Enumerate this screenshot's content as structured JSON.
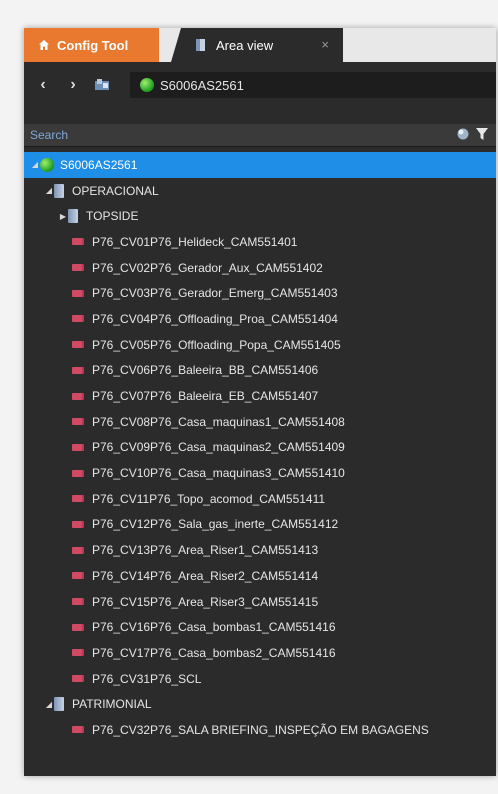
{
  "tabs": {
    "config_tool": "Config Tool",
    "area_view": "Area view",
    "close_symbol": "×"
  },
  "nav": {
    "back": "‹",
    "forward": "›",
    "location": "S6006AS2561"
  },
  "search": {
    "placeholder": "Search"
  },
  "tree": {
    "root": "S6006AS2561",
    "group1": "OPERACIONAL",
    "subgroup1": "TOPSIDE",
    "cameras1": [
      "P76_CV01P76_Helideck_CAM551401",
      "P76_CV02P76_Gerador_Aux_CAM551402",
      "P76_CV03P76_Gerador_Emerg_CAM551403",
      "P76_CV04P76_Offloading_Proa_CAM551404",
      "P76_CV05P76_Offloading_Popa_CAM551405",
      "P76_CV06P76_Baleeira_BB_CAM551406",
      "P76_CV07P76_Baleeira_EB_CAM551407",
      "P76_CV08P76_Casa_maquinas1_CAM551408",
      "P76_CV09P76_Casa_maquinas2_CAM551409",
      "P76_CV10P76_Casa_maquinas3_CAM551410",
      "P76_CV11P76_Topo_acomod_CAM551411",
      "P76_CV12P76_Sala_gas_inerte_CAM551412",
      "P76_CV13P76_Area_Riser1_CAM551413",
      "P76_CV14P76_Area_Riser2_CAM551414",
      "P76_CV15P76_Area_Riser3_CAM551415",
      "P76_CV16P76_Casa_bombas1_CAM551416",
      "P76_CV17P76_Casa_bombas2_CAM551416",
      "P76_CV31P76_SCL"
    ],
    "group2": "PATRIMONIAL",
    "cameras2": [
      "P76_CV32P76_SALA BRIEFING_INSPEÇÃO EM BAGAGENS"
    ]
  },
  "colors": {
    "accent_orange": "#e8792f",
    "selection_blue": "#1f8ee6",
    "panel_dark": "#2b2b2b"
  }
}
